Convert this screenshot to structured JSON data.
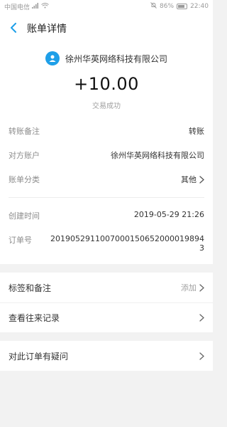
{
  "status": {
    "carrier": "中国电信",
    "battery": "86%",
    "time": "22:40"
  },
  "nav": {
    "title": "账单详情"
  },
  "summary": {
    "payee": "徐州华英网络科技有限公司",
    "amount": "+10.00",
    "status": "交易成功"
  },
  "details": [
    {
      "key": "转账备注",
      "value": "转账"
    },
    {
      "key": "对方账户",
      "value": "徐州华英网络科技有限公司"
    },
    {
      "key": "账单分类",
      "value": "其他"
    },
    {
      "key": "创建时间",
      "value": "2019-05-29 21:26"
    },
    {
      "key": "订单号",
      "value": "20190529110070001506520000198943"
    }
  ],
  "actions": {
    "tags": {
      "label": "标签和备注",
      "action": "添加"
    },
    "history": {
      "label": "查看往来记录"
    },
    "question": {
      "label": "对此订单有疑问"
    }
  }
}
